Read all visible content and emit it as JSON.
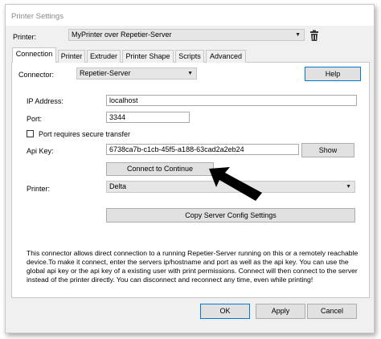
{
  "window": {
    "title": "Printer Settings"
  },
  "printer_row": {
    "label": "Printer:",
    "selected": "MyPrinter over Repetier-Server",
    "arrow": "▼",
    "delete_icon": "trash-icon"
  },
  "tabs": [
    {
      "label": "Connection",
      "active": true
    },
    {
      "label": "Printer",
      "active": false
    },
    {
      "label": "Extruder",
      "active": false
    },
    {
      "label": "Printer Shape",
      "active": false
    },
    {
      "label": "Scripts",
      "active": false
    },
    {
      "label": "Advanced",
      "active": false
    }
  ],
  "connection": {
    "connector_label": "Connector:",
    "connector_value": "Repetier-Server",
    "help_button": "Help",
    "ip_label": "IP Address:",
    "ip_value": "localhost",
    "port_label": "Port:",
    "port_value": "3344",
    "secure_label": "Port requires secure transfer",
    "secure_checked": false,
    "apikey_label": "Api Key:",
    "apikey_value": "6738ca7b-c1cb-45f5-a188-63cad2a2eb24",
    "show_button": "Show",
    "connect_button": "Connect to Continue",
    "printer_label": "Printer:",
    "printer_value": "Delta",
    "copy_button": "Copy Server Config Settings",
    "description": "This connector allows direct connection to a running Repetier-Server running on this or a remotely reachable device.To make it connect, enter the servers ip/hostname and port as well as the api key. You can use the global api key or the api key of a existing user with print permissions. Connect will then connect to the server instead of the printer directly. You can disconnect and reconnect any time, even while printing!"
  },
  "footer": {
    "ok": "OK",
    "apply": "Apply",
    "cancel": "Cancel"
  },
  "annotation": {
    "arrow_color": "#000000"
  }
}
